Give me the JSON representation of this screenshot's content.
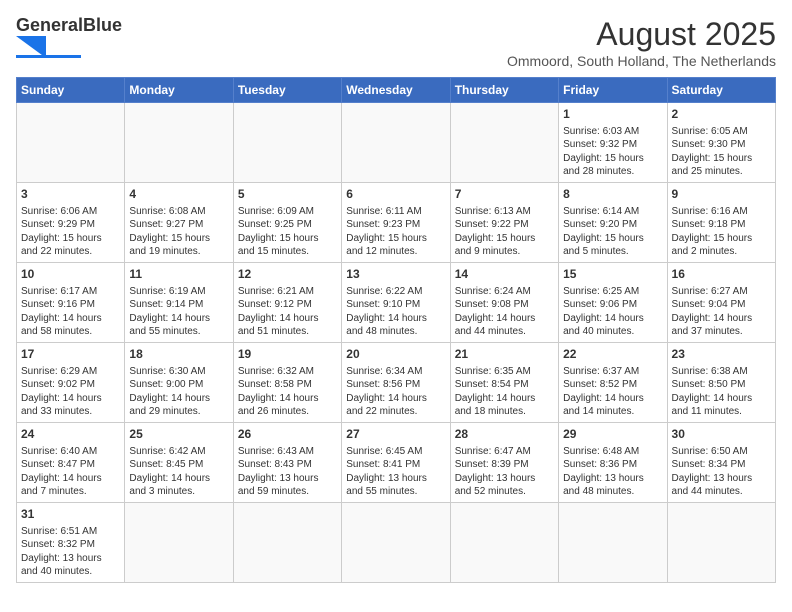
{
  "header": {
    "logo_general": "General",
    "logo_blue": "Blue",
    "title": "August 2025",
    "subtitle": "Ommoord, South Holland, The Netherlands"
  },
  "weekdays": [
    "Sunday",
    "Monday",
    "Tuesday",
    "Wednesday",
    "Thursday",
    "Friday",
    "Saturday"
  ],
  "weeks": [
    [
      {
        "day": "",
        "info": ""
      },
      {
        "day": "",
        "info": ""
      },
      {
        "day": "",
        "info": ""
      },
      {
        "day": "",
        "info": ""
      },
      {
        "day": "",
        "info": ""
      },
      {
        "day": "1",
        "info": "Sunrise: 6:03 AM\nSunset: 9:32 PM\nDaylight: 15 hours\nand 28 minutes."
      },
      {
        "day": "2",
        "info": "Sunrise: 6:05 AM\nSunset: 9:30 PM\nDaylight: 15 hours\nand 25 minutes."
      }
    ],
    [
      {
        "day": "3",
        "info": "Sunrise: 6:06 AM\nSunset: 9:29 PM\nDaylight: 15 hours\nand 22 minutes."
      },
      {
        "day": "4",
        "info": "Sunrise: 6:08 AM\nSunset: 9:27 PM\nDaylight: 15 hours\nand 19 minutes."
      },
      {
        "day": "5",
        "info": "Sunrise: 6:09 AM\nSunset: 9:25 PM\nDaylight: 15 hours\nand 15 minutes."
      },
      {
        "day": "6",
        "info": "Sunrise: 6:11 AM\nSunset: 9:23 PM\nDaylight: 15 hours\nand 12 minutes."
      },
      {
        "day": "7",
        "info": "Sunrise: 6:13 AM\nSunset: 9:22 PM\nDaylight: 15 hours\nand 9 minutes."
      },
      {
        "day": "8",
        "info": "Sunrise: 6:14 AM\nSunset: 9:20 PM\nDaylight: 15 hours\nand 5 minutes."
      },
      {
        "day": "9",
        "info": "Sunrise: 6:16 AM\nSunset: 9:18 PM\nDaylight: 15 hours\nand 2 minutes."
      }
    ],
    [
      {
        "day": "10",
        "info": "Sunrise: 6:17 AM\nSunset: 9:16 PM\nDaylight: 14 hours\nand 58 minutes."
      },
      {
        "day": "11",
        "info": "Sunrise: 6:19 AM\nSunset: 9:14 PM\nDaylight: 14 hours\nand 55 minutes."
      },
      {
        "day": "12",
        "info": "Sunrise: 6:21 AM\nSunset: 9:12 PM\nDaylight: 14 hours\nand 51 minutes."
      },
      {
        "day": "13",
        "info": "Sunrise: 6:22 AM\nSunset: 9:10 PM\nDaylight: 14 hours\nand 48 minutes."
      },
      {
        "day": "14",
        "info": "Sunrise: 6:24 AM\nSunset: 9:08 PM\nDaylight: 14 hours\nand 44 minutes."
      },
      {
        "day": "15",
        "info": "Sunrise: 6:25 AM\nSunset: 9:06 PM\nDaylight: 14 hours\nand 40 minutes."
      },
      {
        "day": "16",
        "info": "Sunrise: 6:27 AM\nSunset: 9:04 PM\nDaylight: 14 hours\nand 37 minutes."
      }
    ],
    [
      {
        "day": "17",
        "info": "Sunrise: 6:29 AM\nSunset: 9:02 PM\nDaylight: 14 hours\nand 33 minutes."
      },
      {
        "day": "18",
        "info": "Sunrise: 6:30 AM\nSunset: 9:00 PM\nDaylight: 14 hours\nand 29 minutes."
      },
      {
        "day": "19",
        "info": "Sunrise: 6:32 AM\nSunset: 8:58 PM\nDaylight: 14 hours\nand 26 minutes."
      },
      {
        "day": "20",
        "info": "Sunrise: 6:34 AM\nSunset: 8:56 PM\nDaylight: 14 hours\nand 22 minutes."
      },
      {
        "day": "21",
        "info": "Sunrise: 6:35 AM\nSunset: 8:54 PM\nDaylight: 14 hours\nand 18 minutes."
      },
      {
        "day": "22",
        "info": "Sunrise: 6:37 AM\nSunset: 8:52 PM\nDaylight: 14 hours\nand 14 minutes."
      },
      {
        "day": "23",
        "info": "Sunrise: 6:38 AM\nSunset: 8:50 PM\nDaylight: 14 hours\nand 11 minutes."
      }
    ],
    [
      {
        "day": "24",
        "info": "Sunrise: 6:40 AM\nSunset: 8:47 PM\nDaylight: 14 hours\nand 7 minutes."
      },
      {
        "day": "25",
        "info": "Sunrise: 6:42 AM\nSunset: 8:45 PM\nDaylight: 14 hours\nand 3 minutes."
      },
      {
        "day": "26",
        "info": "Sunrise: 6:43 AM\nSunset: 8:43 PM\nDaylight: 13 hours\nand 59 minutes."
      },
      {
        "day": "27",
        "info": "Sunrise: 6:45 AM\nSunset: 8:41 PM\nDaylight: 13 hours\nand 55 minutes."
      },
      {
        "day": "28",
        "info": "Sunrise: 6:47 AM\nSunset: 8:39 PM\nDaylight: 13 hours\nand 52 minutes."
      },
      {
        "day": "29",
        "info": "Sunrise: 6:48 AM\nSunset: 8:36 PM\nDaylight: 13 hours\nand 48 minutes."
      },
      {
        "day": "30",
        "info": "Sunrise: 6:50 AM\nSunset: 8:34 PM\nDaylight: 13 hours\nand 44 minutes."
      }
    ],
    [
      {
        "day": "31",
        "info": "Sunrise: 6:51 AM\nSunset: 8:32 PM\nDaylight: 13 hours\nand 40 minutes."
      },
      {
        "day": "",
        "info": ""
      },
      {
        "day": "",
        "info": ""
      },
      {
        "day": "",
        "info": ""
      },
      {
        "day": "",
        "info": ""
      },
      {
        "day": "",
        "info": ""
      },
      {
        "day": "",
        "info": ""
      }
    ]
  ]
}
